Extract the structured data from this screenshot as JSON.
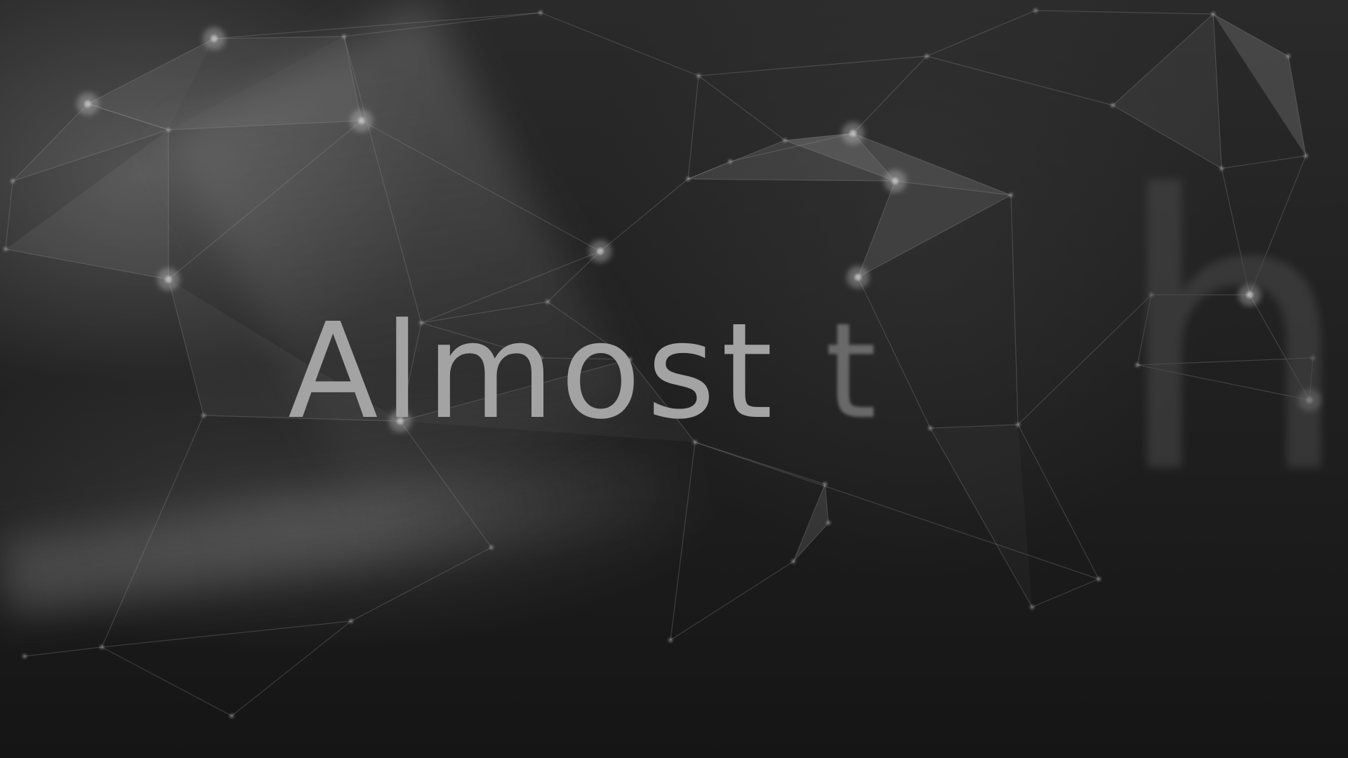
{
  "colors": {
    "background": "#161616",
    "main_text": "#a3a3a3",
    "faded_text": "#7a7a7a",
    "network_lines": "#9a9a9a",
    "network_nodes": "#d0d0d0"
  },
  "headline": {
    "word": "Almost",
    "trailing_letter_1": "t",
    "trailing_letter_2": "h"
  },
  "background_art": "plexus-network"
}
